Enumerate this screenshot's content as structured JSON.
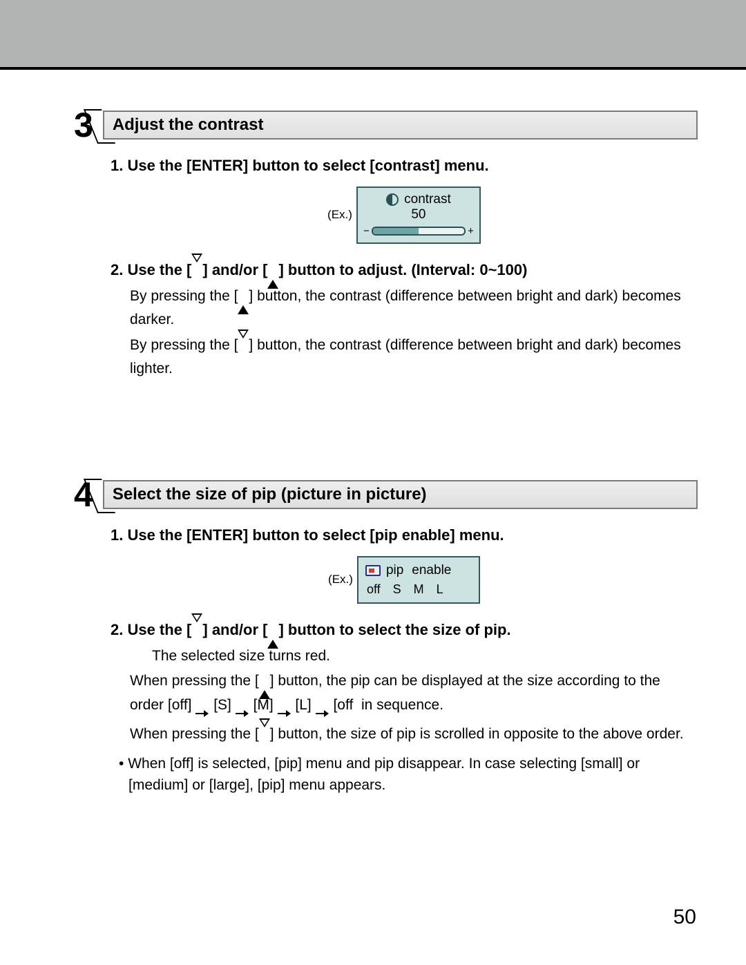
{
  "page_number": "50",
  "example_label": "(Ex.)",
  "step3": {
    "number": "3",
    "title": "Adjust the contrast",
    "sub1_prefix": "1. Use the [ENTER] button to select [",
    "sub1_menu": "contrast",
    "sub1_suffix": "] menu.",
    "osd": {
      "label": "contrast",
      "value": "50",
      "minus": "−",
      "plus": "+"
    },
    "sub2_a": "2. Use the [",
    "sub2_b": "] and/or [",
    "sub2_c": "] button to adjust. (Interval: 0~100)",
    "para1_a": "By pressing the [",
    "para1_b": "] button, the contrast (difference between bright and dark) becomes darker.",
    "para2_a": "By pressing the [",
    "para2_b": "] button, the contrast (difference between bright and dark) becomes lighter."
  },
  "step4": {
    "number": "4",
    "title": "Select the size of pip (picture in picture)",
    "sub1_prefix": "1. Use the [ENTER] button to select [",
    "sub1_menu": "pip enable",
    "sub1_suffix": "] menu.",
    "osd": {
      "label_pip": "pip",
      "label_enable": "enable",
      "opt_off": "off",
      "opt_s": "S",
      "opt_m": "M",
      "opt_l": "L"
    },
    "sub2_a": "2. Use the [",
    "sub2_b": "] and/or [",
    "sub2_c": "] button to select the size of pip.",
    "line_red": "The selected size turns red.",
    "para1_a": "When pressing the [",
    "para1_b": "] button, the pip can be displayed at the size according to the order [off]",
    "seq_s": "[S]",
    "seq_m": "[M]",
    "seq_l": "[L]",
    "seq_off": "[off",
    "seq_tail": "in sequence.",
    "para2_a": "When pressing the [",
    "para2_b": "] button, the size of pip is scrolled in opposite to the above order.",
    "bullet_a": "When [off] is selected, [pip] menu and pip disappear. In case selecting [",
    "bullet_small": "small",
    "bullet_mid1": "] or [",
    "bullet_medium": "medium",
    "bullet_mid2": "] or [",
    "bullet_large": "large",
    "bullet_b": "], [pip] menu appears."
  }
}
